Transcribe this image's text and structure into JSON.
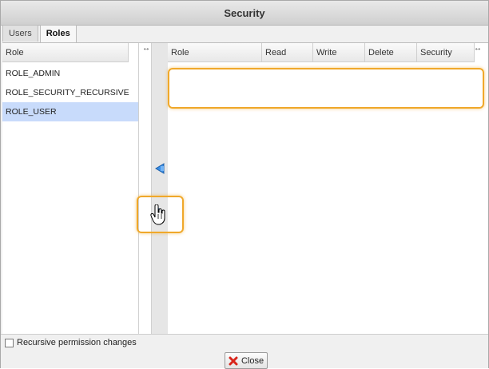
{
  "dialog": {
    "title": "Security"
  },
  "tabs": [
    {
      "label": "Users",
      "active": false
    },
    {
      "label": "Roles",
      "active": true
    }
  ],
  "left_pane": {
    "header": "Role",
    "resize_glyph": "↔",
    "roles": [
      "ROLE_ADMIN",
      "ROLE_SECURITY_RECURSIVE",
      "ROLE_USER"
    ],
    "selected_index": 2
  },
  "permissions": {
    "columns": [
      "Role",
      "Read",
      "Write",
      "Delete",
      "Security"
    ],
    "resize_glyph": "↔",
    "rows": []
  },
  "footer": {
    "recursive_label": "Recursive permission changes",
    "recursive_checked": false,
    "close_label": "Close"
  },
  "colors": {
    "highlight": "#f0a82a",
    "selected_row": "#c8dbfb",
    "arrow_blue": "#3a8ee6",
    "close_red": "#d9261c"
  },
  "icons": [
    "arrow-left-icon",
    "arrow-right-icon",
    "close-icon",
    "hand-cursor-icon",
    "resize-icon"
  ]
}
